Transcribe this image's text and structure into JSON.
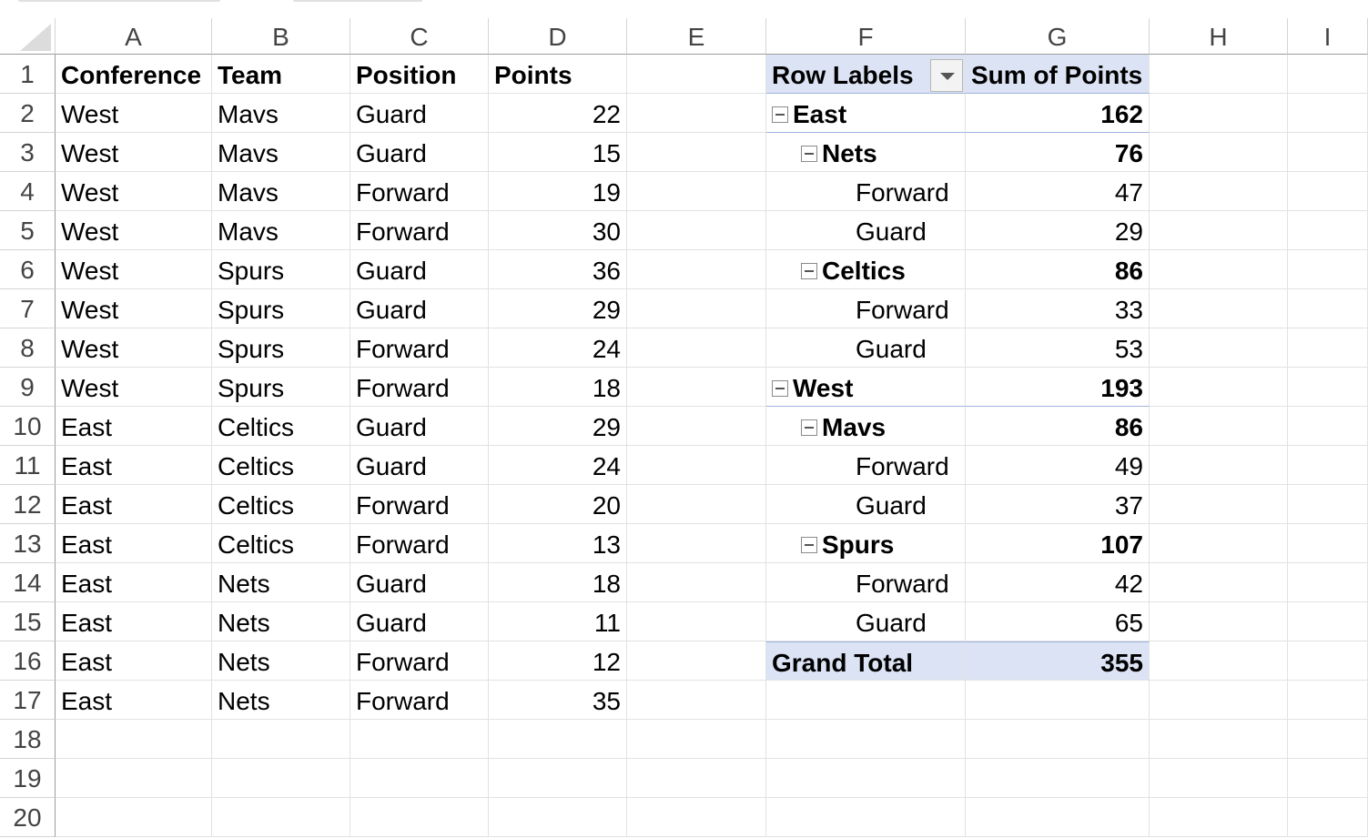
{
  "columns": [
    "A",
    "B",
    "C",
    "D",
    "E",
    "F",
    "G",
    "H",
    "I"
  ],
  "rows": [
    "1",
    "2",
    "3",
    "4",
    "5",
    "6",
    "7",
    "8",
    "9",
    "10",
    "11",
    "12",
    "13",
    "14",
    "15",
    "16",
    "17",
    "18",
    "19",
    "20"
  ],
  "headers": {
    "conference": "Conference",
    "team": "Team",
    "position": "Position",
    "points": "Points"
  },
  "data": [
    {
      "conference": "West",
      "team": "Mavs",
      "position": "Guard",
      "points": "22"
    },
    {
      "conference": "West",
      "team": "Mavs",
      "position": "Guard",
      "points": "15"
    },
    {
      "conference": "West",
      "team": "Mavs",
      "position": "Forward",
      "points": "19"
    },
    {
      "conference": "West",
      "team": "Mavs",
      "position": "Forward",
      "points": "30"
    },
    {
      "conference": "West",
      "team": "Spurs",
      "position": "Guard",
      "points": "36"
    },
    {
      "conference": "West",
      "team": "Spurs",
      "position": "Guard",
      "points": "29"
    },
    {
      "conference": "West",
      "team": "Spurs",
      "position": "Forward",
      "points": "24"
    },
    {
      "conference": "West",
      "team": "Spurs",
      "position": "Forward",
      "points": "18"
    },
    {
      "conference": "East",
      "team": "Celtics",
      "position": "Guard",
      "points": "29"
    },
    {
      "conference": "East",
      "team": "Celtics",
      "position": "Guard",
      "points": "24"
    },
    {
      "conference": "East",
      "team": "Celtics",
      "position": "Forward",
      "points": "20"
    },
    {
      "conference": "East",
      "team": "Celtics",
      "position": "Forward",
      "points": "13"
    },
    {
      "conference": "East",
      "team": "Nets",
      "position": "Guard",
      "points": "18"
    },
    {
      "conference": "East",
      "team": "Nets",
      "position": "Guard",
      "points": "11"
    },
    {
      "conference": "East",
      "team": "Nets",
      "position": "Forward",
      "points": "12"
    },
    {
      "conference": "East",
      "team": "Nets",
      "position": "Forward",
      "points": "35"
    }
  ],
  "pivot": {
    "row_labels_header": "Row Labels",
    "value_header": "Sum of Points",
    "rows": [
      {
        "level": 0,
        "label": "East",
        "value": "162"
      },
      {
        "level": 1,
        "label": "Nets",
        "value": "76"
      },
      {
        "level": 2,
        "label": "Forward",
        "value": "47"
      },
      {
        "level": 2,
        "label": "Guard",
        "value": "29"
      },
      {
        "level": 1,
        "label": "Celtics",
        "value": "86"
      },
      {
        "level": 2,
        "label": "Forward",
        "value": "33"
      },
      {
        "level": 2,
        "label": "Guard",
        "value": "53"
      },
      {
        "level": 0,
        "label": "West",
        "value": "193"
      },
      {
        "level": 1,
        "label": "Mavs",
        "value": "86"
      },
      {
        "level": 2,
        "label": "Forward",
        "value": "49"
      },
      {
        "level": 2,
        "label": "Guard",
        "value": "37"
      },
      {
        "level": 1,
        "label": "Spurs",
        "value": "107"
      },
      {
        "level": 2,
        "label": "Forward",
        "value": "42"
      },
      {
        "level": 2,
        "label": "Guard",
        "value": "65"
      }
    ],
    "grand_total_label": "Grand Total",
    "grand_total_value": "355"
  },
  "icons": {
    "collapse": "collapse-minus-icon",
    "filter": "filter-dropdown-icon"
  },
  "colors": {
    "pivot_header_bg": "#dbe3f4",
    "pivot_line": "#9fb3de",
    "header_text": "#444444"
  }
}
